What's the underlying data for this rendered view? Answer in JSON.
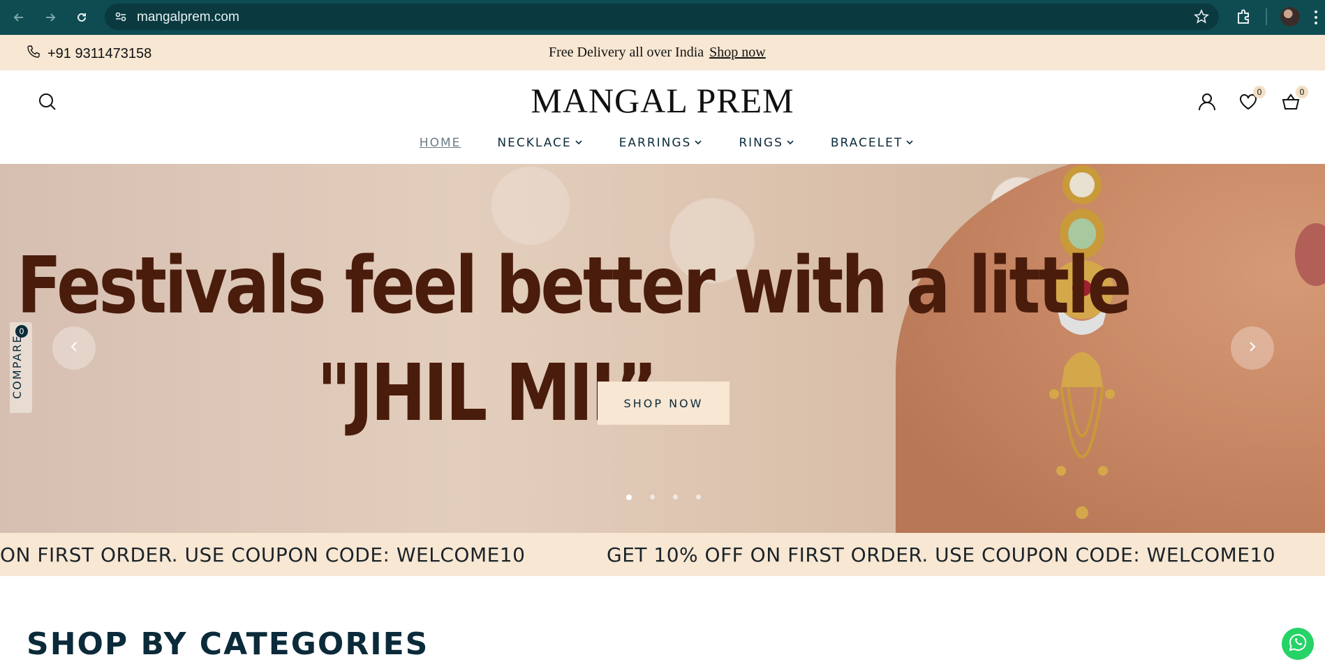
{
  "browser": {
    "url": "mangalprem.com",
    "back_icon": "arrow-left-icon",
    "forward_icon": "arrow-right-icon",
    "reload_icon": "reload-icon"
  },
  "announcement": {
    "phone": "+91 9311473158",
    "message": "Free Delivery all over India",
    "link": "Shop now"
  },
  "header": {
    "logo": "MANGAL PREM",
    "wishlist_count": "0",
    "cart_count": "0"
  },
  "nav": {
    "items": [
      {
        "label": "HOME",
        "active": true
      },
      {
        "label": "NECKLACE",
        "dropdown": true
      },
      {
        "label": "EARRINGS",
        "dropdown": true
      },
      {
        "label": "RINGS",
        "dropdown": true
      },
      {
        "label": "BRACELET",
        "dropdown": true
      }
    ]
  },
  "hero": {
    "headline_line1": "Festivals feel better with a little",
    "headline_line2": "\"JHIL MIL”",
    "cta": "SHOP NOW",
    "slides": 4,
    "active_slide": 1
  },
  "compare": {
    "label": "COMPARE",
    "count": "0"
  },
  "marquee": {
    "text_partial": "ON FIRST ORDER. USE COUPON CODE: WELCOME10",
    "text_full": "GET 10% OFF ON FIRST ORDER. USE COUPON CODE: WELCOME10"
  },
  "section": {
    "title": "SHOP BY CATEGORIES"
  },
  "colors": {
    "chrome": "#0e4c52",
    "announce_bg": "#f7e7d3",
    "headline": "#4a1c0c",
    "navy": "#0b2a3a"
  }
}
